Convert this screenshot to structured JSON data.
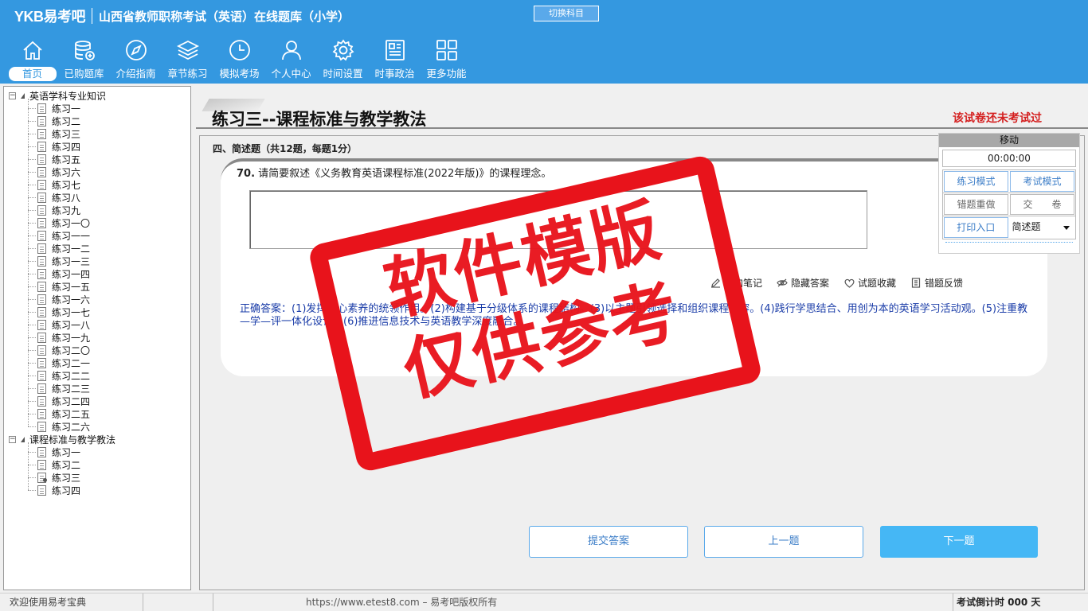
{
  "header": {
    "logo": "YKB易考吧",
    "title": "山西省教师职称考试（英语）在线题库（小学）",
    "switch_button": "切换科目"
  },
  "nav": [
    {
      "label": "首页",
      "icon": "home-icon"
    },
    {
      "label": "已购题库",
      "icon": "database-icon"
    },
    {
      "label": "介绍指南",
      "icon": "compass-icon"
    },
    {
      "label": "章节练习",
      "icon": "layers-icon"
    },
    {
      "label": "模拟考场",
      "icon": "clock-icon"
    },
    {
      "label": "个人中心",
      "icon": "user-icon"
    },
    {
      "label": "时间设置",
      "icon": "gear-icon"
    },
    {
      "label": "时事政治",
      "icon": "news-icon"
    },
    {
      "label": "更多功能",
      "icon": "grid-icon"
    }
  ],
  "tree": {
    "root1": "英语学科专业知识",
    "root1_items": [
      "练习一",
      "练习二",
      "练习三",
      "练习四",
      "练习五",
      "练习六",
      "练习七",
      "练习八",
      "练习九",
      "练习一〇",
      "练习一一",
      "练习一二",
      "练习一三",
      "练习一四",
      "练习一五",
      "练习一六",
      "练习一七",
      "练习一八",
      "练习一九",
      "练习二〇",
      "练习二一",
      "练习二二",
      "练习二三",
      "练习二四",
      "练习二五",
      "练习二六"
    ],
    "root2": "课程标准与教学教法",
    "root2_items": [
      "练习一",
      "练习二",
      "练习三",
      "练习四"
    ]
  },
  "main": {
    "page_title": "练习三--课程标准与教学教法",
    "exam_status": "该试卷还未考试过",
    "section_header": "四、简述题（共12题，每题1分）",
    "question_number": "70.",
    "question_text": "请简要叙述《义务教育英语课程标准(2022年版)》的课程理念。",
    "actions": {
      "add_note": "添加笔记",
      "hide_answer": "隐藏答案",
      "favorite": "试题收藏",
      "feedback": "错题反馈"
    },
    "correct_answer": "正确答案：(1)发挥核心素养的统领作用。(2)构建基于分级体系的课程结构。(3)以主题引领选择和组织课程内容。(4)践行学思结合、用创为本的英语学习活动观。(5)注重教—学—评一体化设计。(6)推进信息技术与英语教学深度融合。",
    "buttons": {
      "submit": "提交答案",
      "prev": "上一题",
      "next": "下一题"
    }
  },
  "control_panel": {
    "move_label": "移动",
    "timer": "00:00:00",
    "practice_mode": "练习模式",
    "exam_mode": "考试模式",
    "redo_wrong": "错题重做",
    "submit_paper": "交　　卷",
    "print": "打印入口",
    "question_type": "简述题"
  },
  "watermark": {
    "line1": "软件模版",
    "line2": "仅供参考"
  },
  "statusbar": {
    "welcome": "欢迎使用易考宝典",
    "url": "https://www.etest8.com – 易考吧版权所有",
    "countdown": "考试倒计时 000 天"
  },
  "colors": {
    "header_bg": "#3498e0",
    "stamp_red": "#e8131b",
    "answer_blue": "#1a3ca8",
    "status_red": "#d42020"
  }
}
